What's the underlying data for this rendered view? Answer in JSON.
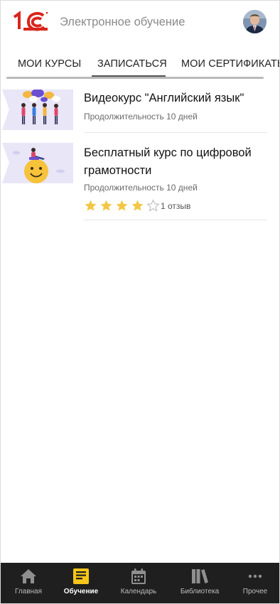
{
  "header": {
    "logo_text": "1С",
    "app_title": "Электронное обучение"
  },
  "tabs": [
    {
      "label": "МОИ КУРСЫ",
      "active": false
    },
    {
      "label": "ЗАПИСАТЬСЯ",
      "active": true
    },
    {
      "label": "МОИ СЕРТИФИКАТЫ",
      "active": false
    }
  ],
  "courses": [
    {
      "title": "Видеокурс \"Английский язык\"",
      "duration": "Продолжительность 10 дней",
      "thumbnail_icon": "people-chatting-illustration"
    },
    {
      "title": "Бесплатный курс по цифровой грамотности",
      "duration": "Продолжительность 10 дней",
      "thumbnail_icon": "smiley-face-illustration",
      "rating": {
        "value": 4,
        "max": 5
      },
      "reviews": "1 отзыв"
    }
  ],
  "bottom_nav": [
    {
      "label": "Главная",
      "icon": "home-icon",
      "active": false
    },
    {
      "label": "Обучение",
      "icon": "learning-icon",
      "active": true
    },
    {
      "label": "Календарь",
      "icon": "calendar-icon",
      "active": false
    },
    {
      "label": "Библиотека",
      "icon": "library-icon",
      "active": false
    },
    {
      "label": "Прочее",
      "icon": "more-icon",
      "active": false
    }
  ],
  "colors": {
    "brand_red": "#d9251c",
    "nav_background": "#1f1f1f",
    "active_icon": "#f5c518",
    "star_filled": "#f2c744",
    "star_empty": "#bdbdbd",
    "thumbnail_bg": "#e8e6f7"
  }
}
